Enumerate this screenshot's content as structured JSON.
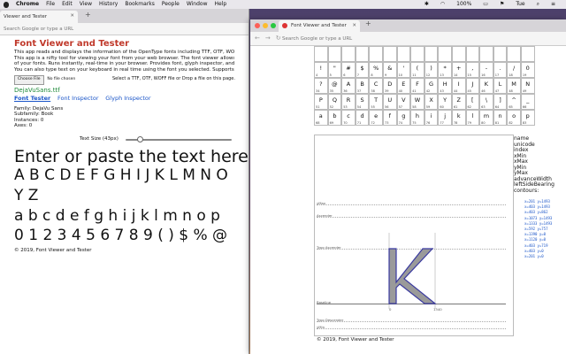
{
  "menubar": {
    "app": "Chrome",
    "items": [
      "File",
      "Edit",
      "View",
      "History",
      "Bookmarks",
      "People",
      "Window",
      "Help"
    ],
    "battery": "100%",
    "day": "Tue"
  },
  "window_left": {
    "tab_title": "Viewer and Tester",
    "url_placeholder": "Search Google or type a URL",
    "title": "Font Viewer and Tester",
    "desc_lines": [
      "This app reads and displays the information of the OpenType fonts including TTF, OTF, WOFF fo",
      "This app is a nifty tool for viewing your font from your web browser. The font viewer allows you t",
      "of your fonts. Runs instantly, real-time in your browser. Provides font, glyph inspector, and variab",
      "You can also type text on your keyboard in real time using the font you selected. Supports only th"
    ],
    "choose_file": "Choose File",
    "no_file": "No file chosen",
    "drop_text": "Select a TTF, OTF, WOFF file or Drop a file on this page.",
    "filename": "DejaVuSans.ttf",
    "links": [
      "Font Tester",
      "Font Inspector",
      "Glyph Inspector"
    ],
    "info": [
      "Family: DejaVu Sans",
      "Subfamily: Book",
      "Instances: 0",
      "Axes: 0"
    ],
    "text_size_label": "Text Size (43px)",
    "slider_value": 0.13,
    "sample_line1": "Enter or paste the text here",
    "sample_line2": "A B C D E F G H I J K L M N O",
    "sample_line3": "Y Z",
    "sample_line4": "a b c d e f g h i j k l m n o p",
    "sample_line5": "0 1 2 3 4 5 6 7 8 9 ( ) $ % @",
    "footer": "© 2019, Font Viewer and Tester"
  },
  "window_right": {
    "tab_title": "Font Viewer and Tester",
    "url_placeholder": "Search Google or type a URL",
    "glyph_rows": [
      {
        "chars": [
          "",
          "",
          "",
          "",
          "",
          "",
          "",
          "",
          "",
          "",
          "",
          "",
          "",
          "",
          "",
          ""
        ],
        "nums": [
          "",
          "",
          "",
          "",
          "",
          "",
          "",
          "",
          "",
          "",
          "",
          "",
          "",
          "",
          "",
          ""
        ]
      },
      {
        "chars": [
          "!",
          "\"",
          "#",
          "$",
          "%",
          "&",
          "'",
          "(",
          ")",
          "*",
          "+",
          ",",
          "-",
          ".",
          "/",
          "0"
        ],
        "nums": [
          "4",
          "5",
          "6",
          "7",
          "8",
          "9",
          "10",
          "11",
          "12",
          "13",
          "14",
          "15",
          "16",
          "17",
          "18",
          "19"
        ]
      },
      {
        "chars": [
          "?",
          "@",
          "A",
          "B",
          "C",
          "D",
          "E",
          "F",
          "G",
          "H",
          "I",
          "J",
          "K",
          "L",
          "M",
          "N"
        ],
        "nums": [
          "34",
          "35",
          "36",
          "37",
          "38",
          "39",
          "40",
          "41",
          "42",
          "43",
          "44",
          "45",
          "46",
          "47",
          "48",
          "49"
        ]
      },
      {
        "chars": [
          "P",
          "Q",
          "R",
          "S",
          "T",
          "U",
          "V",
          "W",
          "X",
          "Y",
          "Z",
          "[",
          "\\",
          "]",
          "^",
          "_"
        ],
        "nums": [
          "51",
          "52",
          "53",
          "54",
          "55",
          "56",
          "57",
          "58",
          "59",
          "60",
          "61",
          "62",
          "63",
          "64",
          "65",
          "66"
        ]
      },
      {
        "chars": [
          "a",
          "b",
          "c",
          "d",
          "e",
          "f",
          "g",
          "h",
          "i",
          "j",
          "k",
          "l",
          "m",
          "n",
          "o",
          "p"
        ],
        "nums": [
          "68",
          "69",
          "70",
          "71",
          "72",
          "73",
          "74",
          "75",
          "76",
          "77",
          "78",
          "79",
          "80",
          "81",
          "82",
          "83"
        ]
      }
    ],
    "glyph_labels": [
      "yMax",
      "Ascender",
      "Typo Ascender",
      "Baseline",
      "Typo Descender",
      "yMin"
    ],
    "glyph_axis": [
      "0",
      "1340"
    ],
    "selected_glyph": "K",
    "props": [
      "name",
      "unicode",
      "index",
      "xMin",
      "xMax",
      "yMin",
      "yMax",
      "advanceWidth",
      "leftSideBearing",
      "contours:"
    ],
    "contours": [
      "x=201 y=1493",
      "x=403 y=1493",
      "x=403 y=862",
      "x=1073 y=1493",
      "x=1333 y=1493",
      "x=592 y=757",
      "x=1390 y=0",
      "x=1120 y=0",
      "x=403 y=719",
      "x=403 y=0",
      "x=201 y=0"
    ],
    "footer": "© 2019, Font Viewer and Tester"
  }
}
